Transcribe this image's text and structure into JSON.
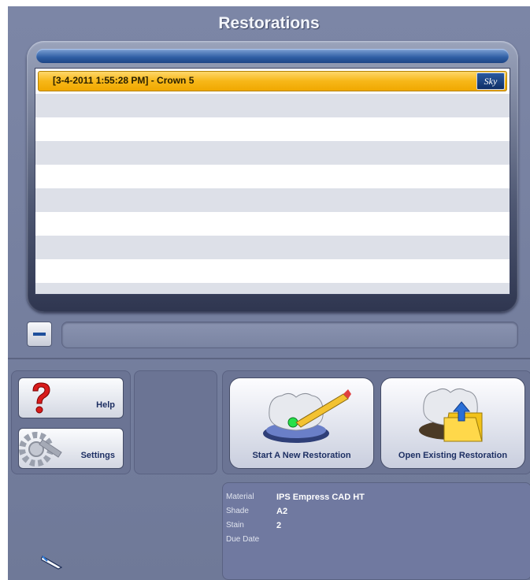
{
  "window": {
    "title": "Restorations"
  },
  "list": {
    "items": [
      {
        "label": "[3-4-2011 1:55:28 PM] - Crown 5",
        "badge": "Sky",
        "selected": true
      }
    ]
  },
  "buttons": {
    "help": "Help",
    "settings": "Settings",
    "start": "Start A New Restoration",
    "open": "Open Existing Restoration"
  },
  "info": {
    "material_label": "Material",
    "material_value": "IPS Empress CAD HT",
    "shade_label": "Shade",
    "shade_value": "A2",
    "stain_label": "Stain",
    "stain_value": "2",
    "due_label": "Due Date",
    "due_value": ""
  },
  "colors": {
    "background": "#7c86a6",
    "selected_row": "#f7b718",
    "accent_blue": "#1e4f9c"
  },
  "icons": [
    "minus-icon",
    "help-question-icon",
    "settings-gear-icon",
    "tooth-pencil-icon",
    "tooth-folder-icon",
    "pen-cursor-icon"
  ]
}
